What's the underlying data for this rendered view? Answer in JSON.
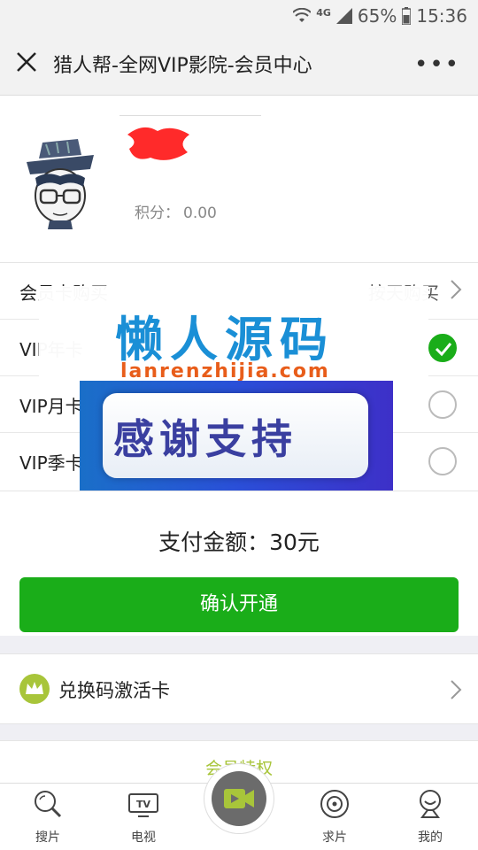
{
  "status_bar": {
    "network": "4G",
    "battery": "65%",
    "time": "15:36"
  },
  "nav": {
    "title": "猎人帮-全网VIP影院-会员中心",
    "more": "•••"
  },
  "profile": {
    "points_label": "积分：",
    "points_value": "0.00"
  },
  "membership": {
    "header_label": "会员卡购买",
    "header_right": "按天购买",
    "options": [
      {
        "label": "VIP年卡",
        "checked": true
      },
      {
        "label": "VIP月卡",
        "checked": false
      },
      {
        "label": "VIP季卡",
        "checked": false
      }
    ]
  },
  "watermark": {
    "title": "懒人源码",
    "url": "lanrenzhijia.com",
    "banner": "感谢支持"
  },
  "payment": {
    "amount_text": "支付金额：30元",
    "confirm_label": "确认开通"
  },
  "redeem": {
    "label": "兑换码激活卡"
  },
  "privileges": {
    "label": "会员特权"
  },
  "tabbar": {
    "items": [
      {
        "label": "搜片",
        "icon": "search-icon"
      },
      {
        "label": "电视",
        "icon": "tv-icon"
      },
      {
        "label": "",
        "icon": "video-camera-icon"
      },
      {
        "label": "求片",
        "icon": "request-icon"
      },
      {
        "label": "我的",
        "icon": "profile-icon"
      }
    ]
  },
  "colors": {
    "accent_green": "#1aad19",
    "crown_green": "#a8c53a",
    "watermark_blue": "#1a8fd6",
    "watermark_orange": "#e85d1a"
  }
}
